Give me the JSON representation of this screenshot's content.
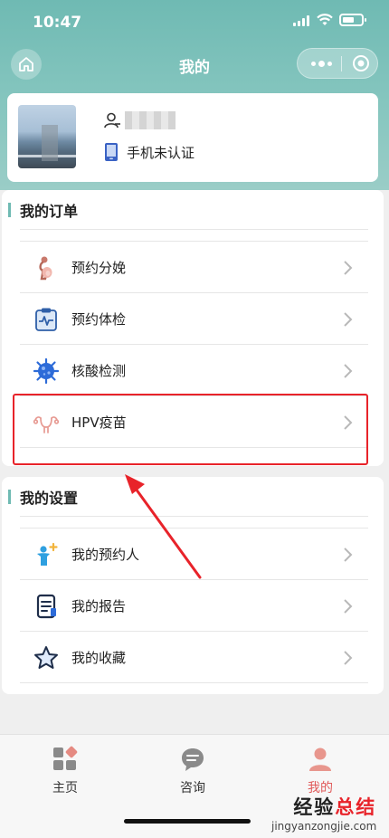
{
  "status_bar": {
    "time": "10:47"
  },
  "nav": {
    "title": "我的"
  },
  "profile": {
    "phone_status": "手机未认证"
  },
  "orders": {
    "title": "我的订单",
    "items": [
      {
        "label": "预约分娩",
        "icon": "pregnant-icon"
      },
      {
        "label": "预约体检",
        "icon": "clipboard-checkup-icon"
      },
      {
        "label": "核酸检测",
        "icon": "virus-icon"
      },
      {
        "label": "HPV疫苗",
        "icon": "uterus-icon"
      }
    ]
  },
  "settings": {
    "title": "我的设置",
    "items": [
      {
        "label": "我的预约人",
        "icon": "person-add-icon"
      },
      {
        "label": "我的报告",
        "icon": "report-document-icon"
      },
      {
        "label": "我的收藏",
        "icon": "star-icon"
      }
    ]
  },
  "tabbar": {
    "items": [
      {
        "label": "主页",
        "icon": "home-grid-icon"
      },
      {
        "label": "咨询",
        "icon": "chat-bubble-icon"
      },
      {
        "label": "我的",
        "icon": "user-profile-icon"
      }
    ],
    "active_color": "#e05a5a"
  },
  "watermark": {
    "line1_a": "经验",
    "line1_b": "总结",
    "line2": "jingyanzongjie.com"
  },
  "colors": {
    "header": "#7ec2bb",
    "accent": "#6fbab3",
    "highlight": "#e8232a"
  }
}
